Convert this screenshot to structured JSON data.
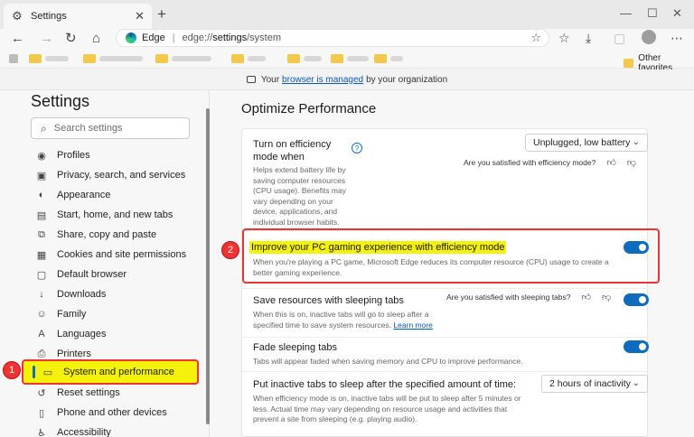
{
  "tab": {
    "title": "Settings",
    "icon": "gear-icon"
  },
  "address": {
    "browser_name": "Edge",
    "separator": "|",
    "url_prefix": "edge://",
    "url_host": "settings",
    "url_path": "/system"
  },
  "favorites": {
    "other": "Other favorites"
  },
  "managed": {
    "prefix": "Your",
    "link": "browser is managed",
    "suffix": "by your organization"
  },
  "sidebar": {
    "title": "Settings",
    "search_placeholder": "Search settings",
    "items": [
      {
        "label": "Profiles",
        "icon": "profile-icon"
      },
      {
        "label": "Privacy, search, and services",
        "icon": "lock-icon"
      },
      {
        "label": "Appearance",
        "icon": "palette-icon"
      },
      {
        "label": "Start, home, and new tabs",
        "icon": "home-icon"
      },
      {
        "label": "Share, copy and paste",
        "icon": "share-icon"
      },
      {
        "label": "Cookies and site permissions",
        "icon": "permissions-icon"
      },
      {
        "label": "Default browser",
        "icon": "browser-icon"
      },
      {
        "label": "Downloads",
        "icon": "download-icon"
      },
      {
        "label": "Family",
        "icon": "family-icon"
      },
      {
        "label": "Languages",
        "icon": "language-icon"
      },
      {
        "label": "Printers",
        "icon": "printer-icon"
      },
      {
        "label": "System and performance",
        "icon": "laptop-icon"
      },
      {
        "label": "Reset settings",
        "icon": "reset-icon"
      },
      {
        "label": "Phone and other devices",
        "icon": "phone-icon"
      },
      {
        "label": "Accessibility",
        "icon": "accessibility-icon"
      }
    ]
  },
  "badges": {
    "one": "1",
    "two": "2"
  },
  "main": {
    "title": "Optimize Performance",
    "efficiency": {
      "title": "Turn on efficiency mode when",
      "desc": "Helps extend battery life by saving computer resources (CPU usage). Benefits may vary depending on your device, applications, and individual browser habits.",
      "dropdown": "Unplugged, low battery",
      "feedback": "Are you satisfied with efficiency mode?"
    },
    "gaming": {
      "title": "Improve your PC gaming experience with efficiency mode",
      "desc": "When you're playing a PC game, Microsoft Edge reduces its computer resource (CPU) usage to create a better gaming experience.",
      "enabled": true
    },
    "sleeping": {
      "title": "Save resources with sleeping tabs",
      "desc": "When this is on, inactive tabs will go to sleep after a specified time to save system resources.",
      "link": "Learn more",
      "feedback": "Are you satisfied with sleeping tabs?",
      "enabled": true
    },
    "fade": {
      "title": "Fade sleeping tabs",
      "desc": "Tabs will appear faded when saving memory and CPU to improve performance.",
      "enabled": true
    },
    "inactive": {
      "title": "Put inactive tabs to sleep after the specified amount of time:",
      "desc": "When efficiency mode is on, inactive tabs will be put to sleep after 5 minutes or less. Actual time may vary depending on resource usage and activities that prevent a site from sleeping (e.g. playing audio).",
      "dropdown": "2 hours of inactivity"
    }
  }
}
